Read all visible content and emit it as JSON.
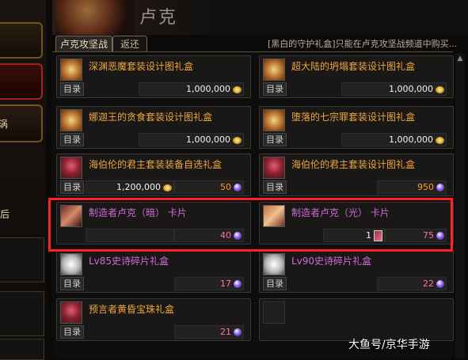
{
  "window": {
    "title": "卢克",
    "tabs": [
      {
        "label": "卢克攻坚战",
        "active": true
      },
      {
        "label": "返还",
        "active": false
      }
    ],
    "notice": "[黑白的守护礼盒]只能在卢克攻坚战频道中购买..."
  },
  "left_panel": {
    "label1": "涡",
    "label2": "后"
  },
  "catalog_label": "目录",
  "items": [
    {
      "name": "深渊恶魔套装设计图礼盒",
      "price": "1,000,000",
      "currency": "gold"
    },
    {
      "name": "超大陆的坍塌套装设计图礼盒",
      "price": "1,000,000",
      "currency": "gold"
    },
    {
      "name": "娜迦王的贪食套装设计图礼盒",
      "price": "1,000,000",
      "currency": "gold"
    },
    {
      "name": "堕落的七宗罪套装设计图礼盒",
      "price": "1,000,000",
      "currency": "gold"
    },
    {
      "name": "海伯伦的君主套装装备自选礼盒",
      "price": "1,200,000",
      "currency": "gold",
      "extra_price": "50",
      "extra_currency": "orb"
    },
    {
      "name": "海伯伦的君主套装设计图礼盒",
      "price": "950",
      "currency": "orb"
    },
    {
      "name": "制造者卢克（暗） 卡片",
      "price": "40",
      "currency": "orb"
    },
    {
      "name": "制造者卢克（光） 卡片",
      "card_cost": "1",
      "price": "75",
      "currency": "orb"
    },
    {
      "name": "Lv85史诗碎片礼盒",
      "price": "17",
      "currency": "orb"
    },
    {
      "name": "Lv90史诗碎片礼盒",
      "price": "22",
      "currency": "orb"
    },
    {
      "name": "预言者黄昏宝珠礼盒",
      "price": "21",
      "currency": "orb"
    }
  ],
  "colors": {
    "highlight_border": "#ff2020",
    "gold_item_name": "#f0a63a",
    "purple_item_name": "#d06ad8",
    "orb_price": "#ff6fb8"
  },
  "watermark": "大鱼号/京华手游"
}
